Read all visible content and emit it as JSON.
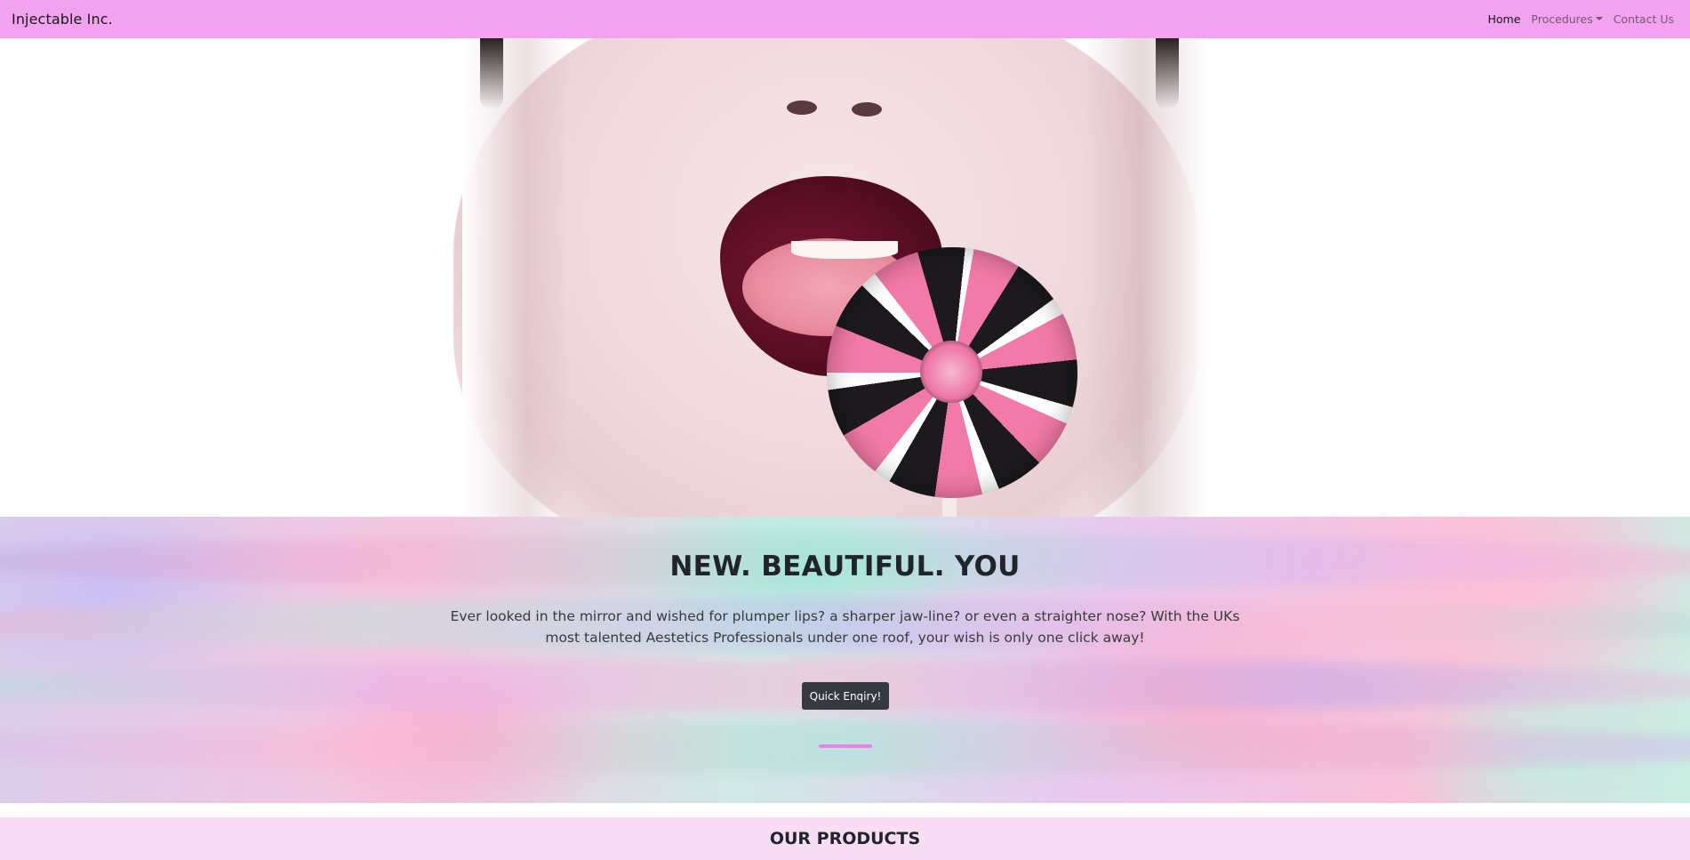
{
  "navbar": {
    "brand": "Injectable Inc.",
    "links": [
      {
        "label": "Home",
        "active": true
      },
      {
        "label": "Procedures",
        "dropdown": true
      },
      {
        "label": "Contact Us"
      }
    ],
    "background": "#f1a3f0"
  },
  "hero": {
    "image_subject": "lips-with-lollipop"
  },
  "intro": {
    "headline": "NEW. BEAUTIFUL. YOU",
    "text": "Ever looked in the mirror and wished for plumper lips? a sharper jaw-line? or even a straighter nose? With the UKs most talented Aestetics Professionals under one roof, your wish is only one click away!",
    "button_label": "Quick Enqiry!",
    "divider_color": "#e384e8"
  },
  "products": {
    "title": "OUR PRODUCTS",
    "background": "#f8ddf5"
  }
}
